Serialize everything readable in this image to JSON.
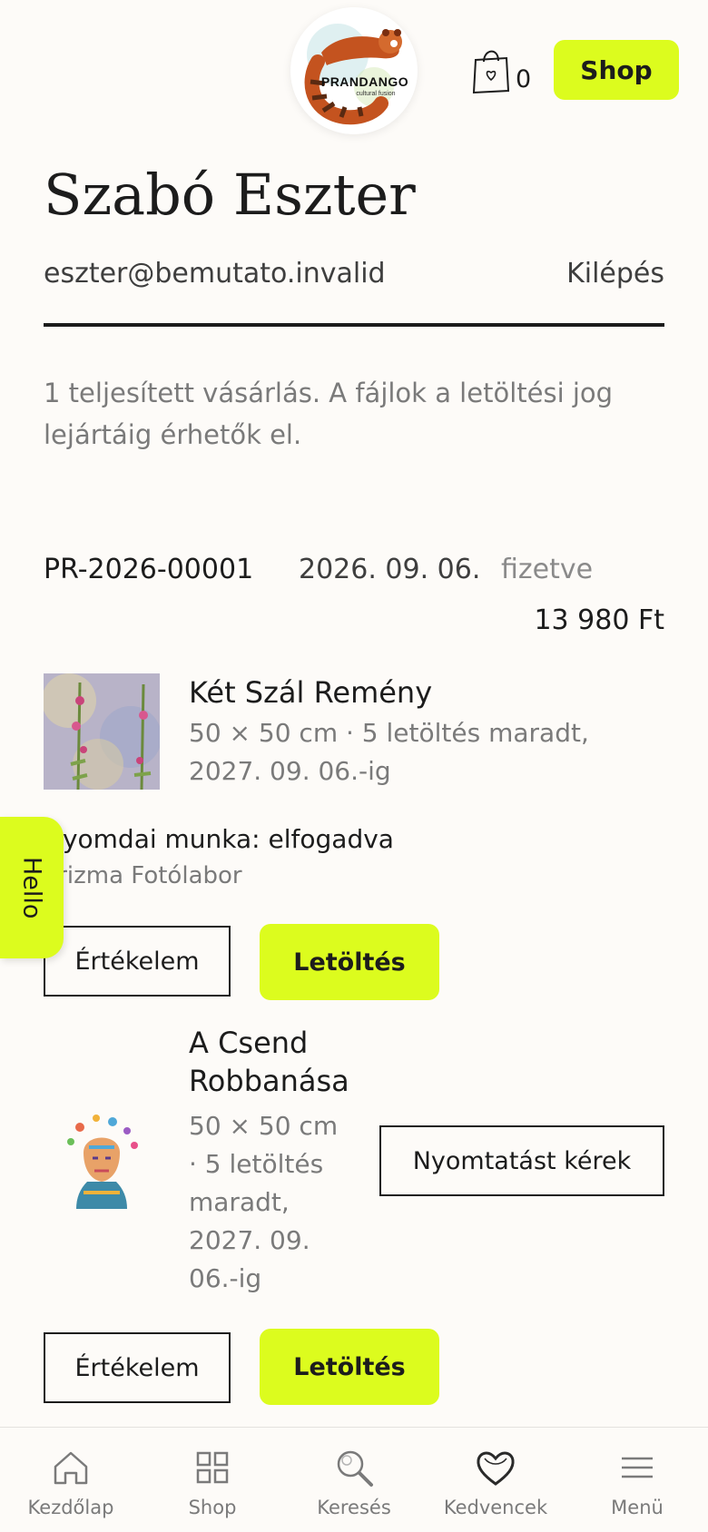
{
  "header": {
    "logo_text": "PRANDANGO",
    "logo_tagline": "cultural fusion",
    "cart_count": "0",
    "shop_label": "Shop"
  },
  "profile": {
    "name": "Szabó Eszter",
    "email": "eszter@bemutato.invalid",
    "logout_label": "Kilépés",
    "summary": "1 teljesített vásárlás. A fájlok a letöltési jog lejártáig érhetők el."
  },
  "order": {
    "id": "PR-2026-00001",
    "date": "2026. 09. 06.",
    "status": "fizetve",
    "total": "13 980 Ft",
    "items": [
      {
        "title": "Két Szál Remény",
        "meta": "50 × 50 cm · 5 letöltés maradt, 2027. 09. 06.-ig",
        "print_status": "Nyomdai munka: elfogadva",
        "print_lab": "Prizma Fotólabor",
        "review_label": "Értékelem",
        "download_label": "Letöltés"
      },
      {
        "title": "A Csend Robbanása",
        "meta": "50 × 50 cm · 5 letöltés maradt, 2027. 09. 06.-ig",
        "print_request_label": "Nyomtatást kérek",
        "review_label": "Értékelem",
        "download_label": "Letöltés"
      }
    ]
  },
  "floating": {
    "hello_label": "Hello"
  },
  "bottom_nav": [
    {
      "label": "Kezdőlap",
      "icon": "home-icon"
    },
    {
      "label": "Shop",
      "icon": "grid-icon"
    },
    {
      "label": "Keresés",
      "icon": "search-icon"
    },
    {
      "label": "Kedvencek",
      "icon": "heart-icon"
    },
    {
      "label": "Menü",
      "icon": "menu-icon"
    }
  ],
  "colors": {
    "background": "#fdfbf8",
    "accent": "#dcfc1e",
    "text": "#1c1c1c",
    "muted": "#7a7a7a"
  }
}
